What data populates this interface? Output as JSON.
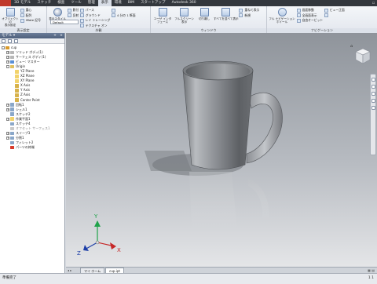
{
  "ribbon_tabs": [
    "3D モデル",
    "スケッチ",
    "検査",
    "ツール",
    "管理",
    "表示",
    "環境",
    "BIM",
    "スタートアップ",
    "Autodesk 360"
  ],
  "active_tab_index": 5,
  "ribbon": {
    "visibility": {
      "big_label": "オブジェクトの\n表示設定",
      "items": [
        "重心",
        "配列",
        "iMate 記号"
      ],
      "title": "表示設定"
    },
    "appearance": {
      "big_label": "表示スタイル",
      "items_a": [
        "影付",
        "反射"
      ],
      "items_b": [
        "パース",
        "グラウンド",
        "レイ トレーシング",
        "テクスチャ オン"
      ],
      "items_c": [
        "",
        "4 分の 1 断面"
      ],
      "dropdown": "Default",
      "title": "外観"
    },
    "windows": {
      "buttons": [
        "ユーザ インタフェース",
        "フルスクリーン 表示",
        "切り離し",
        "すべてを並べて表示"
      ],
      "items": [
        "重ねて表示",
        "新規"
      ],
      "title": "ウィンドウ"
    },
    "navigate": {
      "big_label": "フル ナビゲーション ホイール",
      "items": [
        "画面移動",
        "全画面表示",
        "自由オービット"
      ],
      "items2": [
        "ビュー正面",
        ""
      ],
      "title": "ナビゲーション"
    }
  },
  "browser": {
    "title": "モデル ▾",
    "tree": [
      {
        "label": "cup",
        "level": 0,
        "expander": "-",
        "color": "#d99a2b"
      },
      {
        "label": "ソリッド ボディ(1)",
        "level": 1,
        "expander": "+",
        "color": "#b7b7b7"
      },
      {
        "label": "サーフェス ボディ(1)",
        "level": 1,
        "expander": "+",
        "color": "#b7b7b7"
      },
      {
        "label": "ビュー: マスター",
        "level": 1,
        "expander": "+",
        "color": "#5a8fd6"
      },
      {
        "label": "Origin",
        "level": 1,
        "expander": "-",
        "color": "#e0c060"
      },
      {
        "label": "YZ Plane",
        "level": 2,
        "expander": "",
        "color": "#f2d36b"
      },
      {
        "label": "XZ Plane",
        "level": 2,
        "expander": "",
        "color": "#f2d36b"
      },
      {
        "label": "XY Plane",
        "level": 2,
        "expander": "",
        "color": "#f2d36b"
      },
      {
        "label": "X Axis",
        "level": 2,
        "expander": "",
        "color": "#d7b24a"
      },
      {
        "label": "Y Axis",
        "level": 2,
        "expander": "",
        "color": "#d7b24a"
      },
      {
        "label": "Z Axis",
        "level": 2,
        "expander": "",
        "color": "#d7b24a"
      },
      {
        "label": "Center Point",
        "level": 2,
        "expander": "",
        "color": "#d7b24a"
      },
      {
        "label": "回転1",
        "level": 1,
        "expander": "+",
        "color": "#8aa7c9"
      },
      {
        "label": "シェル1",
        "level": 1,
        "expander": "+",
        "color": "#8aa7c9"
      },
      {
        "label": "スケッチ2",
        "level": 1,
        "expander": "",
        "color": "#8aa7c9"
      },
      {
        "label": "作業平面1",
        "level": 1,
        "expander": "+",
        "color": "#f2d36b"
      },
      {
        "label": "スケッチ4",
        "level": 1,
        "expander": "",
        "color": "#8aa7c9"
      },
      {
        "label": "オフセット サーフェス1",
        "level": 1,
        "expander": "",
        "color": "#c9c9c9",
        "dim": true
      },
      {
        "label": "スイープ3",
        "level": 1,
        "expander": "+",
        "color": "#8aa7c9"
      },
      {
        "label": "分割1",
        "level": 1,
        "expander": "+",
        "color": "#8aa7c9"
      },
      {
        "label": "フィレット2",
        "level": 1,
        "expander": "",
        "color": "#8aa7c9"
      },
      {
        "label": "パーツの終端",
        "level": 1,
        "expander": "",
        "color": "#d83a2b"
      }
    ]
  },
  "viewport": {
    "viewcube_label": "",
    "triad": {
      "x": "X",
      "y": "Y",
      "z": "Z"
    }
  },
  "doc_tabs": [
    "マイ ホーム",
    "cup.ipt"
  ],
  "active_doc_index": 1,
  "status": {
    "left": "準備完了",
    "right": "1   1"
  }
}
